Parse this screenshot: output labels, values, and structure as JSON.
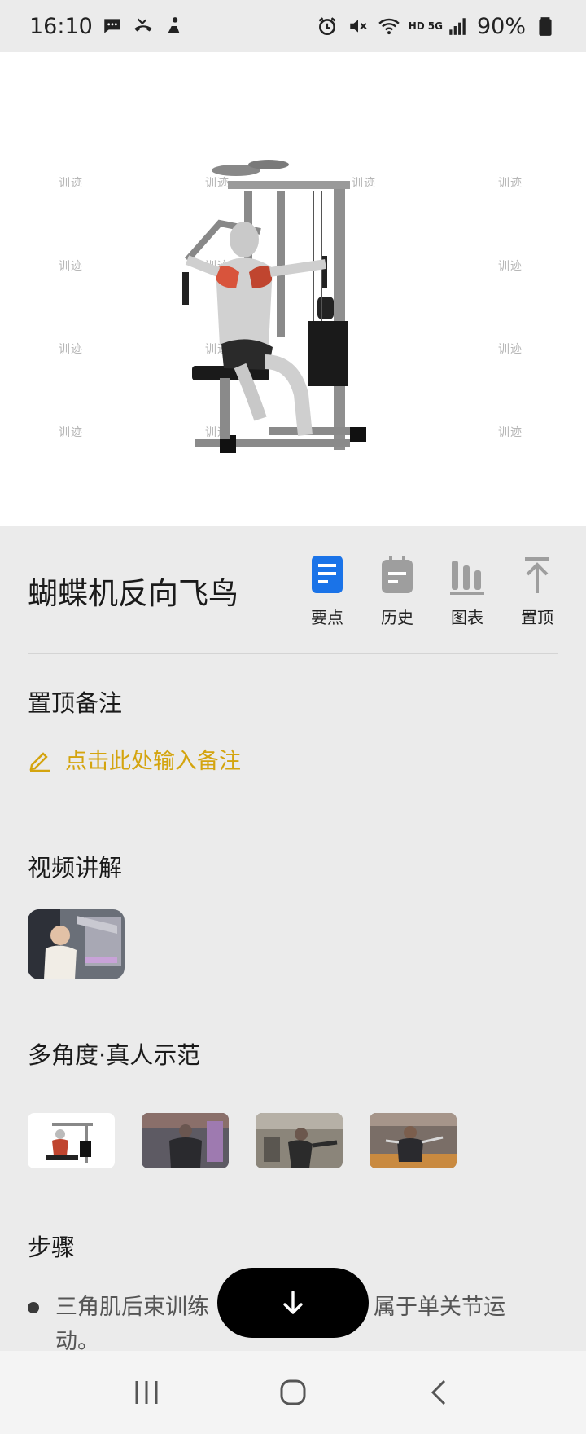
{
  "status_bar": {
    "time": "16:10",
    "network_hd": "HD",
    "network_5g": "5G",
    "battery": "90%",
    "icons": [
      "message-icon",
      "missed-call-icon",
      "person-icon",
      "alarm-icon",
      "mute-icon",
      "wifi-icon",
      "signal-icon",
      "battery-icon"
    ]
  },
  "hero": {
    "watermark": "训迹"
  },
  "exercise": {
    "title": "蝴蝶机反向飞鸟",
    "actions": [
      {
        "label": "要点",
        "icon": "document-icon",
        "color": "#1a73e8",
        "active": true
      },
      {
        "label": "历史",
        "icon": "calendar-icon",
        "color": "#9e9e9e",
        "active": false
      },
      {
        "label": "图表",
        "icon": "bar-chart-icon",
        "color": "#9e9e9e",
        "active": false
      },
      {
        "label": "置顶",
        "icon": "pin-top-icon",
        "color": "#9e9e9e",
        "active": false
      }
    ]
  },
  "pinned_note": {
    "title": "置顶备注",
    "placeholder": "点击此处输入备注",
    "accent": "#d4a40e"
  },
  "video": {
    "title": "视频讲解"
  },
  "angles": {
    "title": "多角度·真人示范"
  },
  "steps": {
    "title": "步骤",
    "items": [
      "三角肌后束训练动作，属于单关节运动。"
    ],
    "visible_first_line": "三角肌后束训练",
    "visible_after_button": "属于单关节运",
    "visible_second_line": "动。"
  },
  "nav": {
    "icons": [
      "recent-apps-icon",
      "home-icon",
      "back-icon"
    ]
  }
}
